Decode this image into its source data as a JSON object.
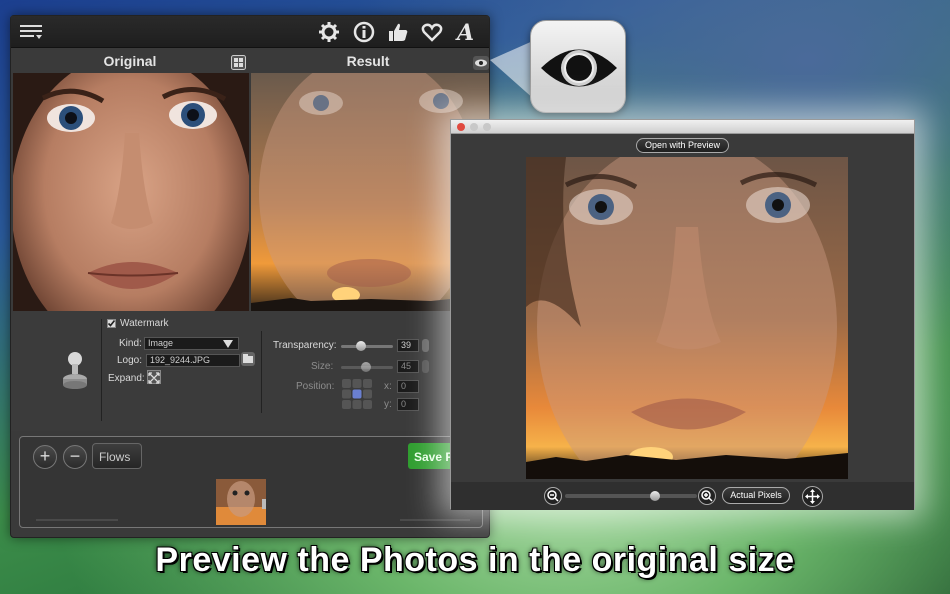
{
  "headers": {
    "original": "Original",
    "result": "Result"
  },
  "watermark": {
    "checkbox_label": "Watermark",
    "kind_label": "Kind:",
    "kind_value": "Image",
    "logo_label": "Logo:",
    "logo_value": "192_9244.JPG",
    "expand_label": "Expand:",
    "transparency_label": "Transparency:",
    "transparency_value": "39",
    "transparency_level": 39,
    "size_label": "Size:",
    "size_value": "45",
    "position_label": "Position:",
    "x_label": "x:",
    "x_value": "0",
    "y_label": "y:",
    "y_value": "0"
  },
  "flows": {
    "add": "+",
    "remove": "−",
    "dropdown": "Flows",
    "save_button": "Save Res"
  },
  "preview": {
    "open_with_preview": "Open with Preview",
    "actual_pixels": "Actual Pixels"
  },
  "caption": "Preview the Photos in the original size",
  "colors": {
    "save_green": "#2f9e2f",
    "accent_blue": "#4a7fd0"
  },
  "icons": [
    "menu-icon",
    "gear-icon",
    "info-icon",
    "thumbs-up-icon",
    "heart-icon",
    "font-icon",
    "layout-icon",
    "eye-icon",
    "stamp-icon",
    "expand-icon",
    "zoom-out-icon",
    "zoom-in-icon",
    "fullscreen-icon"
  ]
}
